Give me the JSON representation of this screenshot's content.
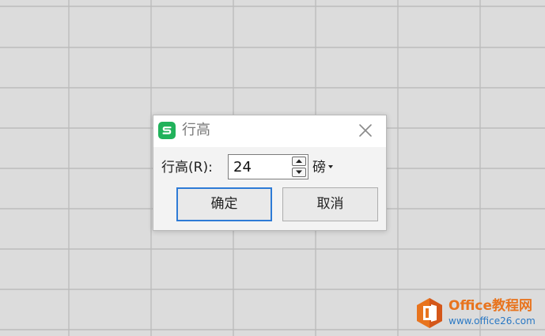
{
  "dialog": {
    "title": "行高",
    "row_label": "行高(R):",
    "value": "24",
    "unit": "磅",
    "ok_label": "确定",
    "cancel_label": "取消",
    "icons": {
      "app": "wps-spreadsheet-icon",
      "close": "close-icon",
      "up": "spin-up-icon",
      "down": "spin-down-icon",
      "dropdown": "chevron-down-icon"
    }
  },
  "watermark": {
    "name": "Office教程网",
    "url": "www.office26.com"
  },
  "colors": {
    "app_icon": "#21b25b",
    "ok_border": "#2e7bd6",
    "grid_background": "#dcdcdc",
    "grid_lines": "#bcbcbc",
    "watermark_orange": "#e8741e",
    "watermark_blue": "#2b79c4"
  }
}
